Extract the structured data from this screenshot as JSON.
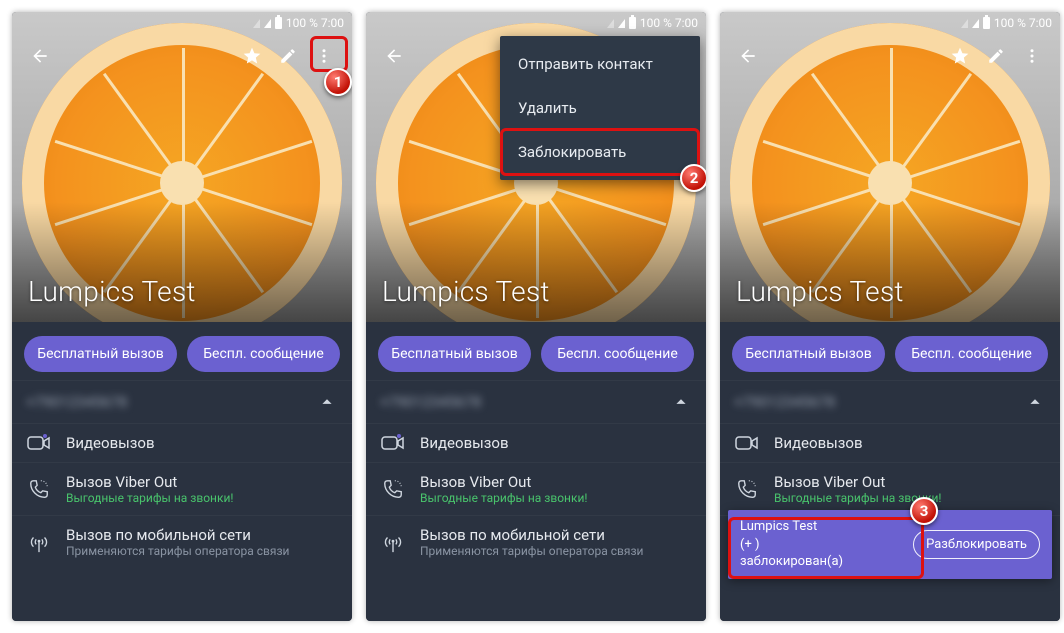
{
  "status": {
    "battery_text": "100 % 7:00"
  },
  "contact": {
    "name": "Lumpics Test",
    "number_blurred": "+79012345678"
  },
  "pills": {
    "call": "Бесплатный вызов",
    "msg": "Беспл. сообщение"
  },
  "rows": {
    "video": "Видеовызов",
    "viberout_title": "Вызов Viber Out",
    "viberout_sub": "Выгодные тарифы на звонки!",
    "cell_title": "Вызов по мобильной сети",
    "cell_sub": "Применяются тарифы оператора связи"
  },
  "dropdown": {
    "send": "Отправить контакт",
    "delete": "Удалить",
    "block": "Заблокировать"
  },
  "snackbar": {
    "line1": "Lumpics Test",
    "line2": "(+                       )",
    "line3": "заблокирован(а)",
    "action": "Разблокировать"
  },
  "badges": {
    "b1": "1",
    "b2": "2",
    "b3": "3"
  }
}
